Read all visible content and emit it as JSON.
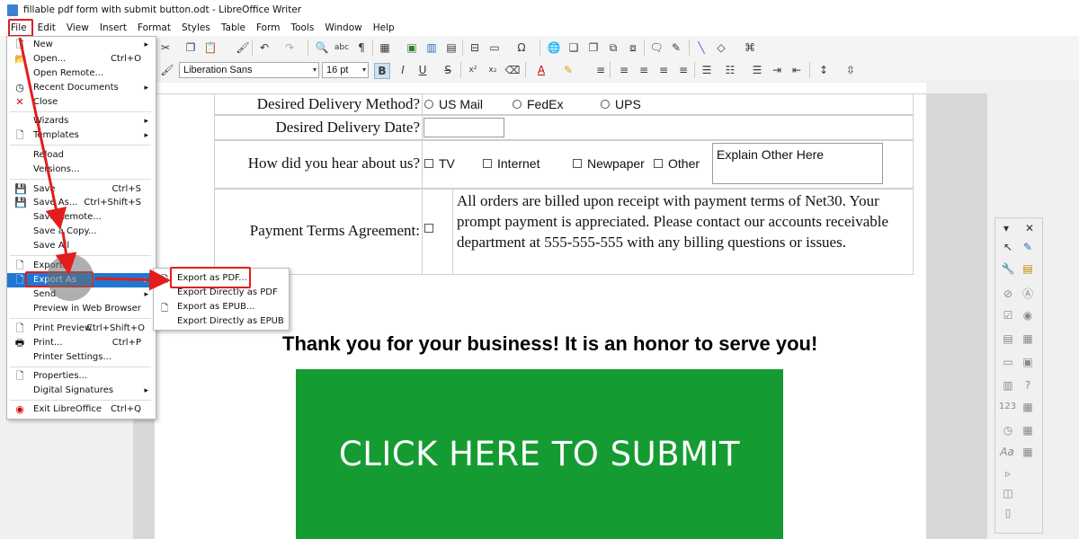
{
  "window": {
    "title": "fillable pdf form with submit button.odt - LibreOffice Writer"
  },
  "menubar": [
    "File",
    "Edit",
    "View",
    "Insert",
    "Format",
    "Styles",
    "Table",
    "Form",
    "Tools",
    "Window",
    "Help"
  ],
  "format": {
    "font_name": "Liberation Sans",
    "font_size": "16 pt"
  },
  "file_menu": {
    "new": "New",
    "open": "Open...",
    "open_sc": "Ctrl+O",
    "open_remote": "Open Remote...",
    "recent": "Recent Documents",
    "close": "Close",
    "wizards": "Wizards",
    "templates": "Templates",
    "reload": "Reload",
    "versions": "Versions...",
    "save": "Save",
    "save_sc": "Ctrl+S",
    "save_as": "Save As...",
    "save_as_sc": "Ctrl+Shift+S",
    "save_remote": "Save Remote...",
    "save_copy": "Save a Copy...",
    "save_all": "Save All",
    "export": "Export...",
    "export_as": "Export As",
    "send": "Send",
    "preview_web": "Preview in Web Browser",
    "print_preview": "Print Preview",
    "print_preview_sc": "Ctrl+Shift+O",
    "print": "Print...",
    "print_sc": "Ctrl+P",
    "printer_settings": "Printer Settings...",
    "properties": "Properties...",
    "digital_signatures": "Digital Signatures",
    "exit": "Exit LibreOffice",
    "exit_sc": "Ctrl+Q"
  },
  "export_submenu": [
    "Export as PDF...",
    "Export Directly as PDF",
    "Export as EPUB...",
    "Export Directly as EPUB"
  ],
  "form": {
    "delivery_label": "Desired Delivery Method?",
    "delivery_options": [
      "US Mail",
      "FedEx",
      "UPS"
    ],
    "date_label": "Desired Delivery Date?",
    "hear_label": "How did you hear about us?",
    "hear_options": [
      "TV",
      "Internet",
      "Newpaper",
      "Other"
    ],
    "explain_placeholder": "Explain Other Here",
    "terms_label": "Payment Terms Agreement:",
    "terms_text": "All orders are billed upon receipt with payment terms of Net30. Your prompt payment is appreciated.  Please contact our accounts receivable department at 555-555-555 with any billing questions or issues.",
    "thanks": "Thank you for your business!  It is an honor to serve you!",
    "submit_label": "CLICK HERE TO SUBMIT"
  },
  "colors": {
    "highlight": "#1e78d3",
    "submit_bg": "#149c33",
    "annotation": "#e21d1d"
  }
}
